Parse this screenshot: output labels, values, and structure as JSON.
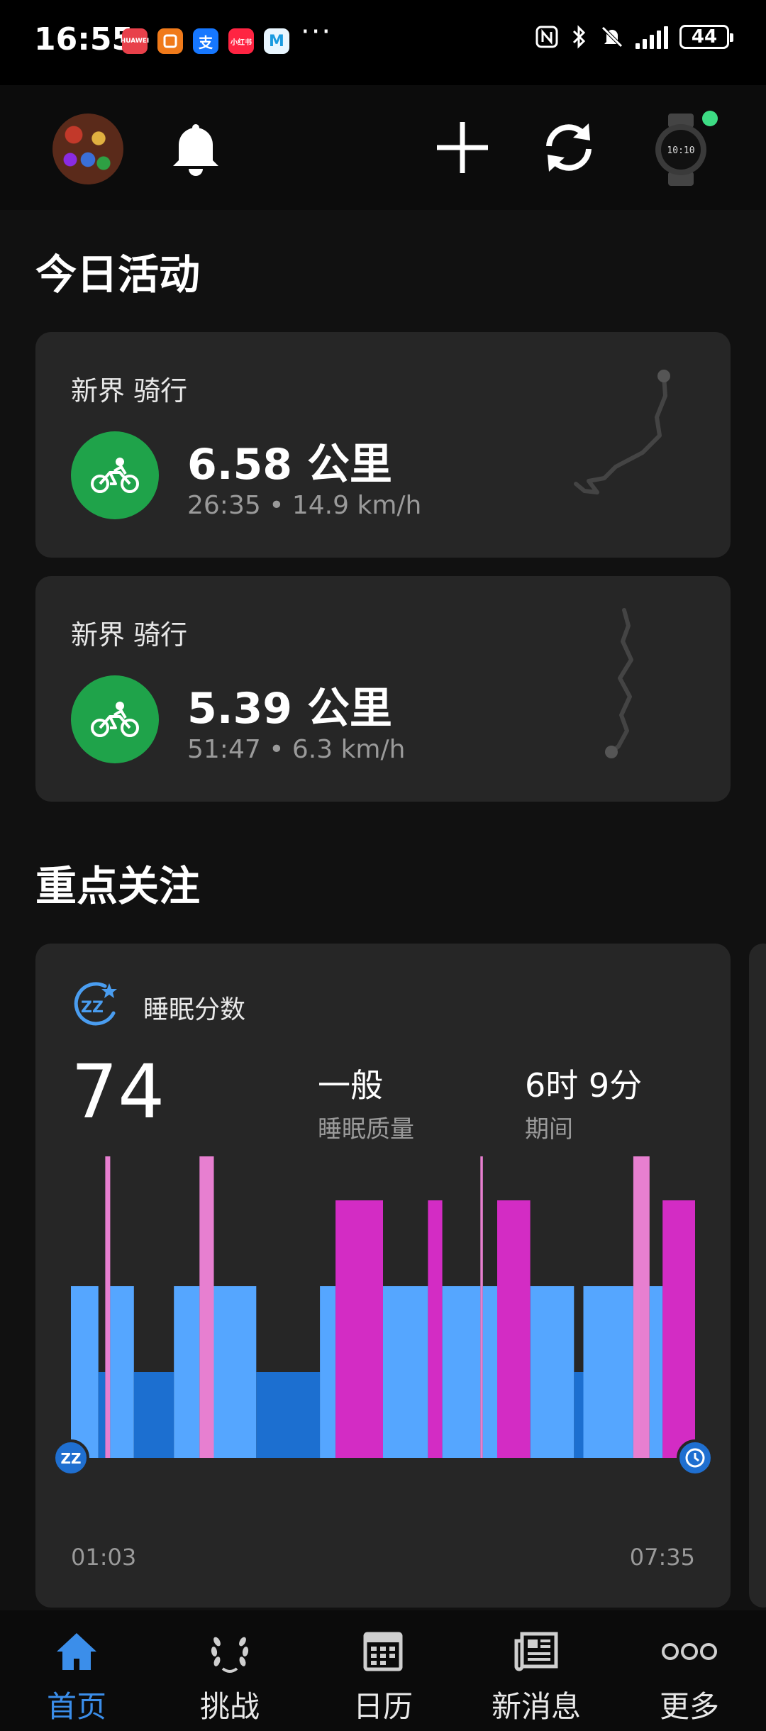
{
  "status_bar": {
    "time": "16:55",
    "app_icons": [
      "HUAWEI",
      "home",
      "支",
      "小红书",
      "M"
    ],
    "more": "···",
    "battery": "44"
  },
  "header": {
    "icons": [
      "avatar",
      "bell-icon",
      "plus-icon",
      "sync-icon",
      "watch-icon"
    ]
  },
  "today": {
    "title": "今日活动",
    "activities": [
      {
        "label": "新界 骑行",
        "distance": "6.58 公里",
        "meta": "26:35 • 14.9 km/h"
      },
      {
        "label": "新界 骑行",
        "distance": "5.39 公里",
        "meta": "51:47 • 6.3 km/h"
      }
    ]
  },
  "focus": {
    "title": "重点关注",
    "sleep": {
      "label": "睡眠分数",
      "score": "74",
      "quality_value": "一般",
      "quality_label": "睡眠质量",
      "duration_value": "6时 9分",
      "duration_label": "期间",
      "start_time": "01:03",
      "end_time": "07:35"
    }
  },
  "chart_data": {
    "type": "bar",
    "levels": [
      "deep",
      "light",
      "rem",
      "awake"
    ],
    "level_values": {
      "deep": 1,
      "light": 2,
      "rem": 3,
      "awake": 4
    },
    "colors": {
      "deep": "#1c6fd0",
      "light": "#55a6ff",
      "rem": "#d32cc4",
      "awake": "#e77fd0"
    },
    "x_start": "01:03",
    "x_end": "07:35",
    "segments": [
      {
        "stage": "light",
        "f0": 0.0,
        "f1": 0.044
      },
      {
        "stage": "deep",
        "f0": 0.044,
        "f1": 0.055
      },
      {
        "stage": "awake",
        "f0": 0.055,
        "f1": 0.063
      },
      {
        "stage": "light",
        "f0": 0.063,
        "f1": 0.101
      },
      {
        "stage": "deep",
        "f0": 0.101,
        "f1": 0.165
      },
      {
        "stage": "light",
        "f0": 0.165,
        "f1": 0.206
      },
      {
        "stage": "awake",
        "f0": 0.206,
        "f1": 0.229
      },
      {
        "stage": "light",
        "f0": 0.229,
        "f1": 0.297
      },
      {
        "stage": "deep",
        "f0": 0.297,
        "f1": 0.399
      },
      {
        "stage": "light",
        "f0": 0.399,
        "f1": 0.424
      },
      {
        "stage": "rem",
        "f0": 0.424,
        "f1": 0.5
      },
      {
        "stage": "light",
        "f0": 0.5,
        "f1": 0.572
      },
      {
        "stage": "rem",
        "f0": 0.572,
        "f1": 0.595
      },
      {
        "stage": "light",
        "f0": 0.595,
        "f1": 0.656
      },
      {
        "stage": "awake",
        "f0": 0.656,
        "f1": 0.66
      },
      {
        "stage": "light",
        "f0": 0.66,
        "f1": 0.683
      },
      {
        "stage": "rem",
        "f0": 0.683,
        "f1": 0.736
      },
      {
        "stage": "light",
        "f0": 0.736,
        "f1": 0.806
      },
      {
        "stage": "deep",
        "f0": 0.806,
        "f1": 0.821
      },
      {
        "stage": "light",
        "f0": 0.821,
        "f1": 0.901
      },
      {
        "stage": "awake",
        "f0": 0.901,
        "f1": 0.927
      },
      {
        "stage": "light",
        "f0": 0.927,
        "f1": 0.948
      },
      {
        "stage": "rem",
        "f0": 0.948,
        "f1": 1.0
      }
    ]
  },
  "bottom_nav": [
    {
      "label": "首页",
      "icon": "home-icon",
      "active": true
    },
    {
      "label": "挑战",
      "icon": "laurel-icon",
      "active": false
    },
    {
      "label": "日历",
      "icon": "calendar-icon",
      "active": false
    },
    {
      "label": "新消息",
      "icon": "news-icon",
      "active": false
    },
    {
      "label": "更多",
      "icon": "more-icon",
      "active": false
    }
  ]
}
